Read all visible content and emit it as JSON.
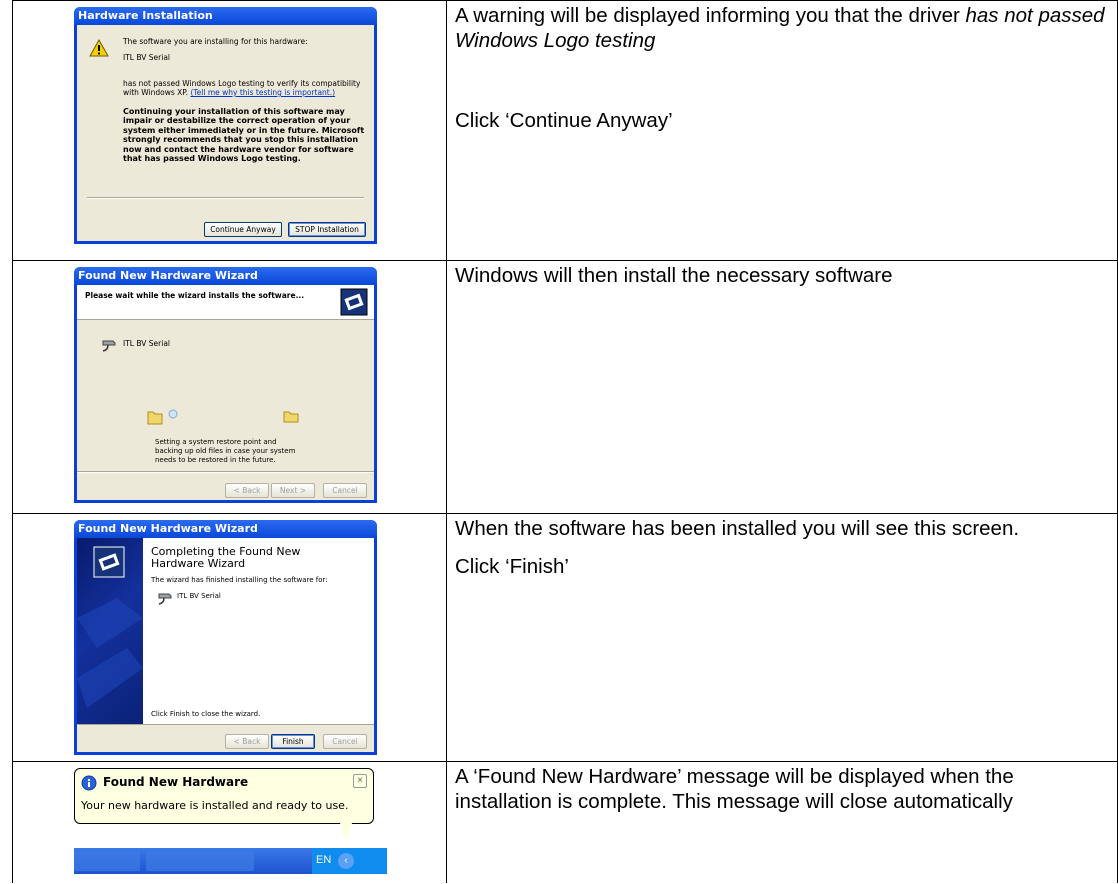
{
  "rows": [
    {
      "dialog": {
        "title": "Hardware Installation",
        "line1": "The software you are installing for this hardware:",
        "device": "ITL BV Serial",
        "para1": "has not passed Windows Logo testing to verify its compatibility with Windows XP.",
        "link": "(Tell me why this testing is important.)",
        "bold": "Continuing your installation of this software may impair or destabilize the correct operation of your system either immediately or in the future. Microsoft strongly recommends that you stop this installation now and contact the hardware vendor for software that has passed Windows Logo testing.",
        "btn_continue": "Continue Anyway",
        "btn_stop": "STOP Installation"
      },
      "text": {
        "p1_a": "A warning will be displayed informing you that the driver ",
        "p1_b": "has not passed Windows Logo testing",
        "p2": "Click ‘Continue Anyway’"
      }
    },
    {
      "dialog": {
        "title": "Found New Hardware Wizard",
        "header": "Please wait while the wizard installs the software...",
        "device": "ITL BV Serial",
        "status": "Setting a system restore point and backing up old files in case your system needs to be restored in the future.",
        "btn_back": "< Back",
        "btn_next": "Next >",
        "btn_cancel": "Cancel"
      },
      "text": {
        "p1": "Windows will then install the necessary software"
      }
    },
    {
      "dialog": {
        "title": "Found New Hardware Wizard",
        "heading": "Completing the Found New Hardware Wizard",
        "finished": "The wizard has finished installing the software for:",
        "device": "ITL BV Serial",
        "close": "Click Finish to close the wizard.",
        "btn_back": "< Back",
        "btn_finish": "Finish",
        "btn_cancel": "Cancel"
      },
      "text": {
        "p1": "When the software has been installed you will see this screen.",
        "p2": "Click ‘Finish’"
      }
    },
    {
      "balloon": {
        "title": "Found New Hardware",
        "message": "Your new hardware is installed and ready to use.",
        "lang": "EN"
      },
      "text": {
        "p1": "A ‘Found New Hardware’ message will be displayed when the installation is complete. This message will close automatically"
      }
    }
  ]
}
